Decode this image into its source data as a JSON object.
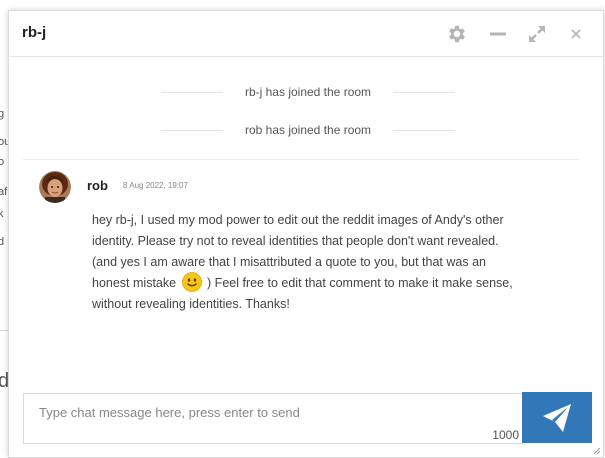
{
  "page_edge": {
    "fragments": [
      "g",
      "ou",
      "o",
      "af",
      "k",
      "d",
      "d"
    ]
  },
  "chat": {
    "title": "rb-j",
    "header_icons": {
      "settings": "gear-icon",
      "minimize": "minimize-icon",
      "expand": "expand-icon",
      "close": "close-icon"
    },
    "system_messages": [
      "rb-j has joined the room",
      "rob has joined the room"
    ],
    "message": {
      "author": "rob",
      "timestamp": "8 Aug 2022, 19:07",
      "lines": [
        "hey rb-j, I used my mod power to edit out the reddit images of Andy's other",
        "identity. Please try not to reveal identities that people don't want revealed.",
        "(and yes I am aware that I misattributed a quote to you, but that was an",
        "honest mistake",
        ") Feel free to edit that comment to make it make sense,",
        "without revealing identities. Thanks!"
      ],
      "emoji": "smiley-emoji"
    },
    "input": {
      "placeholder": "Type chat message here, press enter to send",
      "value": "",
      "char_count": "1000"
    },
    "send_icon": "send-icon"
  },
  "colors": {
    "send_button": "#3277b8",
    "emoji": "#f5c518"
  }
}
